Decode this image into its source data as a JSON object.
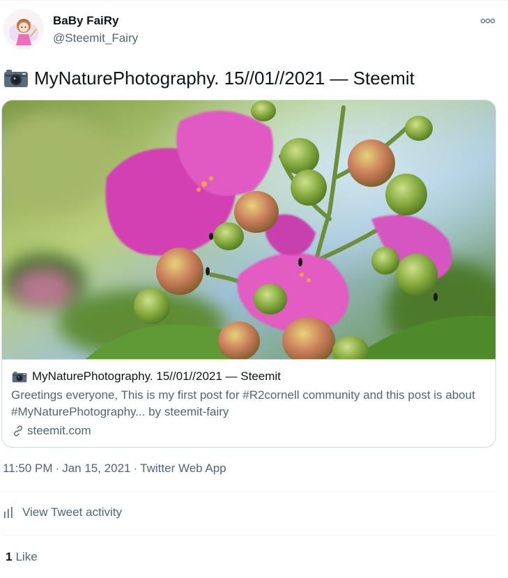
{
  "author": {
    "display_name": "BaBy FaiRy",
    "handle": "@Steemit_Fairy"
  },
  "tweet": {
    "text": "MyNaturePhotography. 15//01//2021 — Steemit"
  },
  "card": {
    "title": "MyNaturePhotography. 15//01//2021 — Steemit",
    "description": "Greetings everyone, This is my first post for #R2cornell community and this post is about #MyNaturePhotography... by steemit-fairy",
    "domain": "steemit.com"
  },
  "meta": {
    "time": "11:50 PM",
    "separator": "·",
    "date": "Jan 15, 2021",
    "source": "Twitter Web App"
  },
  "activity": {
    "label": "View Tweet activity"
  },
  "likes": {
    "count": "1",
    "label": "Like"
  },
  "icons": {
    "more": "more-options-icon",
    "camera": "camera-icon",
    "link": "link-icon",
    "activity": "bar-chart-icon"
  },
  "colors": {
    "text_primary": "#0f1419",
    "text_secondary": "#536471",
    "border": "#cfd9de",
    "divider": "#eff3f4"
  }
}
